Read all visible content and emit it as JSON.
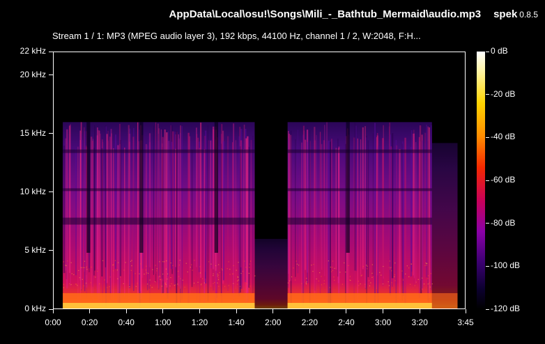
{
  "window": {
    "file_path": "AppData\\Local\\osu!\\Songs\\Mili_-_Bathtub_Mermaid\\audio.mp3",
    "app_name": "spek",
    "app_version": "0.8.5"
  },
  "stream_info": "Stream 1 / 1: MP3 (MPEG audio layer 3), 192 kbps, 44100 Hz, channel 1 / 2, W:2048, F:H...",
  "frequency_axis": {
    "labels": [
      "22 kHz",
      "20 kHz",
      "15 kHz",
      "10 kHz",
      "5 kHz",
      "0 kHz"
    ],
    "values_khz": [
      22,
      20,
      15,
      10,
      5,
      0
    ]
  },
  "time_axis": {
    "labels": [
      "0:00",
      "0:20",
      "0:40",
      "1:00",
      "1:20",
      "1:40",
      "2:00",
      "2:20",
      "2:40",
      "3:00",
      "3:20",
      "3:45"
    ],
    "values_sec": [
      0,
      20,
      40,
      60,
      80,
      100,
      120,
      140,
      160,
      180,
      200,
      225
    ]
  },
  "db_scale": {
    "labels": [
      "0 dB",
      "-20 dB",
      "-40 dB",
      "-60 dB",
      "-80 dB",
      "-100 dB",
      "-120 dB"
    ],
    "values_db": [
      0,
      -20,
      -40,
      -60,
      -80,
      -100,
      -120
    ]
  },
  "colors": {
    "background": "#000000",
    "axis": "#ffffff",
    "spectrum_low": "#3a0070",
    "spectrum_mid": "#c8005a",
    "spectrum_high": "#ff8c00"
  }
}
